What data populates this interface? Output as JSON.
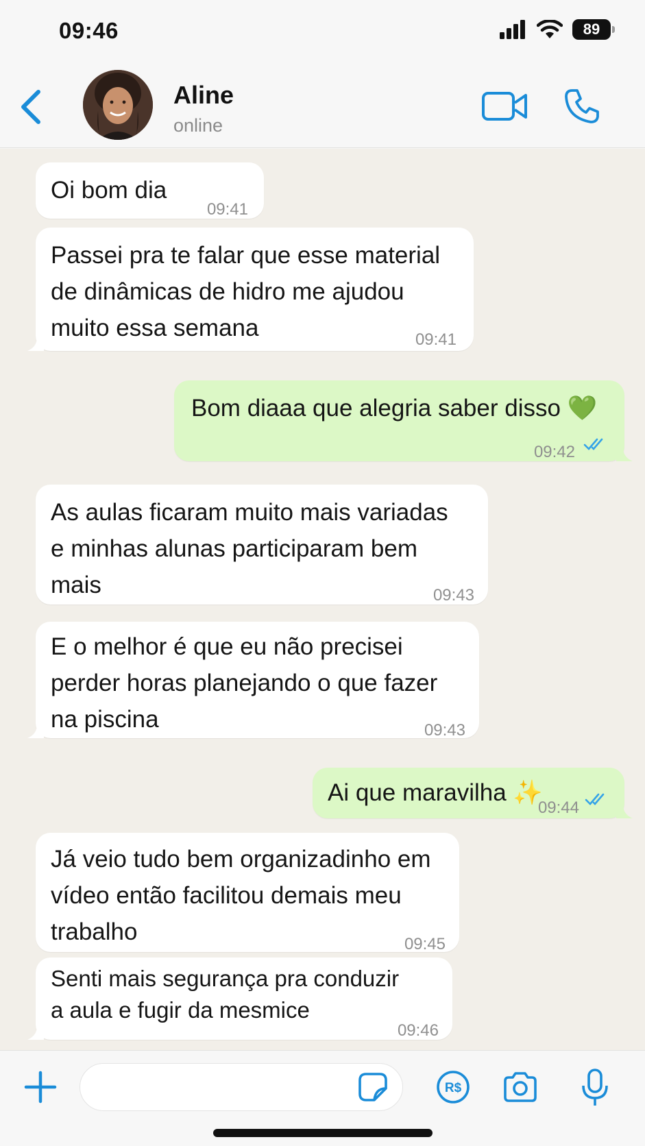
{
  "status_bar": {
    "time": "09:46",
    "battery": "89"
  },
  "header": {
    "contact_name": "Aline",
    "contact_status": "online"
  },
  "messages": [
    {
      "direction": "in",
      "text": "Oi bom dia",
      "time": "09:41"
    },
    {
      "direction": "in",
      "text": "Passei pra te falar que esse material\nde dinâmicas de hidro me ajudou\nmuito essa semana",
      "time": "09:41"
    },
    {
      "direction": "out",
      "text": "Bom diaaa que alegria saber disso 💚",
      "time": "09:42",
      "read": true
    },
    {
      "direction": "in",
      "text": "As aulas ficaram muito mais variadas\ne minhas alunas participaram bem\nmais",
      "time": "09:43"
    },
    {
      "direction": "in",
      "text": "E o melhor é que eu não precisei\nperder horas planejando o que fazer\nna piscina",
      "time": "09:43"
    },
    {
      "direction": "out",
      "text": "Ai que maravilha ✨",
      "time": "09:44",
      "read": true
    },
    {
      "direction": "in",
      "text": "Já veio tudo bem organizadinho em\nvídeo então facilitou demais meu\ntrabalho",
      "time": "09:45"
    },
    {
      "direction": "in",
      "text": "Senti mais segurança pra conduzir\na aula e fugir da mesmice",
      "time": "09:46"
    }
  ],
  "input": {
    "placeholder": ""
  },
  "colors": {
    "accent": "#1a8cd8",
    "outgoing_bubble": "#dcf8c6",
    "incoming_bubble": "#ffffff",
    "chat_background": "#f2efe9",
    "read_ticks": "#34a3e8"
  }
}
